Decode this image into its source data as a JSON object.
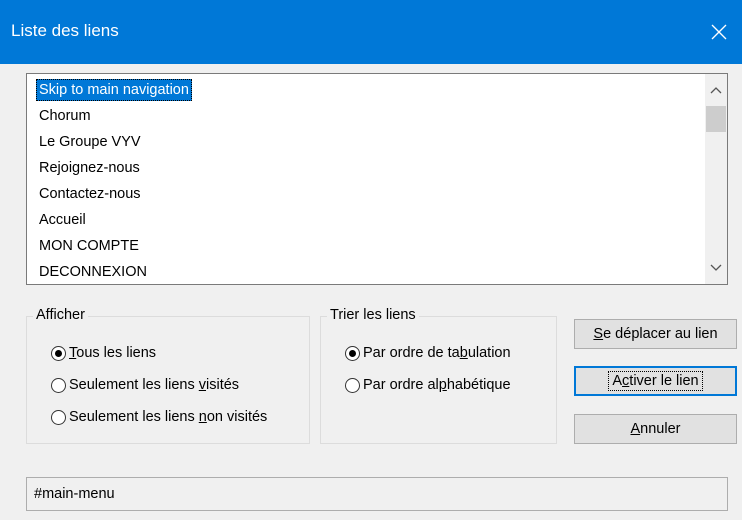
{
  "window": {
    "title": "Liste des liens",
    "close_icon": "close-icon",
    "accent_color": "#0078d7"
  },
  "links": {
    "selected_index": 0,
    "items": [
      "Skip to main navigation",
      "Chorum",
      "Le Groupe VYV",
      "Rejoignez-nous",
      "Contactez-nous",
      "Accueil",
      "MON COMPTE",
      "DECONNEXION"
    ]
  },
  "afficher": {
    "legend": "Afficher",
    "options": [
      {
        "before": "",
        "key": "T",
        "after": "ous les liens",
        "checked": true
      },
      {
        "before": "Seulement les liens ",
        "key": "v",
        "after": "isités",
        "checked": false
      },
      {
        "before": "Seulement les liens ",
        "key": "n",
        "after": "on visités",
        "checked": false
      }
    ]
  },
  "trier": {
    "legend": "Trier les liens",
    "options": [
      {
        "before": "Par ordre de ta",
        "key": "b",
        "after": "ulation",
        "checked": true
      },
      {
        "before": "Par ordre al",
        "key": "p",
        "after": "habétique",
        "checked": false
      }
    ]
  },
  "buttons": {
    "move": {
      "key": "S",
      "rest": "e déplacer au lien"
    },
    "activate": {
      "before": "A",
      "key": "c",
      "after": "tiver le lien"
    },
    "cancel": {
      "key": "A",
      "rest": "nnuler"
    }
  },
  "status": {
    "value": "#main-menu"
  }
}
